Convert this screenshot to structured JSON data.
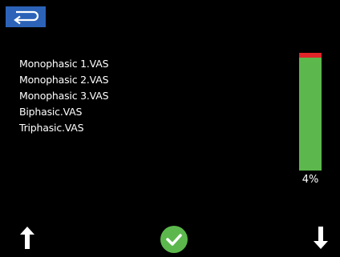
{
  "header": {
    "back_icon": "return-arrow-icon",
    "back_color": "#2c63b8"
  },
  "files": [
    {
      "name": "Monophasic 1.VAS"
    },
    {
      "name": "Monophasic 2.VAS"
    },
    {
      "name": "Monophasic 3.VAS"
    },
    {
      "name": "Biphasic.VAS"
    },
    {
      "name": "Triphasic.VAS"
    }
  ],
  "storage": {
    "used_percent": 4,
    "label": "4%",
    "used_color": "#e0252a",
    "free_color": "#5cb84d"
  },
  "footer": {
    "up_icon": "arrow-up-icon",
    "confirm_icon": "checkmark-icon",
    "down_icon": "arrow-down-icon",
    "confirm_color": "#5cb84d"
  }
}
